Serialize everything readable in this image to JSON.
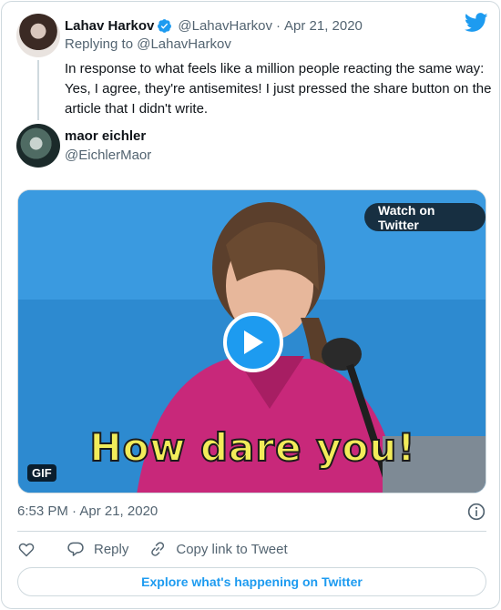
{
  "parent_tweet": {
    "author_name": "Lahav Harkov",
    "author_handle": "@LahavHarkov",
    "separator": "·",
    "date": "Apr 21, 2020",
    "replying_to": "Replying to @LahavHarkov",
    "text": "In response to what feels like a million people reacting the same way: Yes, I agree, they're antisemites! I just pressed the share button on the article that I didn't write.",
    "verified_icon": "verified-badge-icon"
  },
  "main_tweet": {
    "author_name": "maor eichler",
    "author_handle": "@EichlerMaor",
    "media": {
      "watch_label": "Watch on Twitter",
      "badge": "GIF",
      "caption": "How dare you!"
    },
    "timestamp": "6:53 PM · Apr 21, 2020"
  },
  "actions": {
    "reply_label": "Reply",
    "copy_label": "Copy link to Tweet"
  },
  "explore_label": "Explore what's happening on Twitter",
  "colors": {
    "accent": "#1d9bf0",
    "text": "#0f1419",
    "secondary": "#536471",
    "border": "#cfd9de"
  }
}
